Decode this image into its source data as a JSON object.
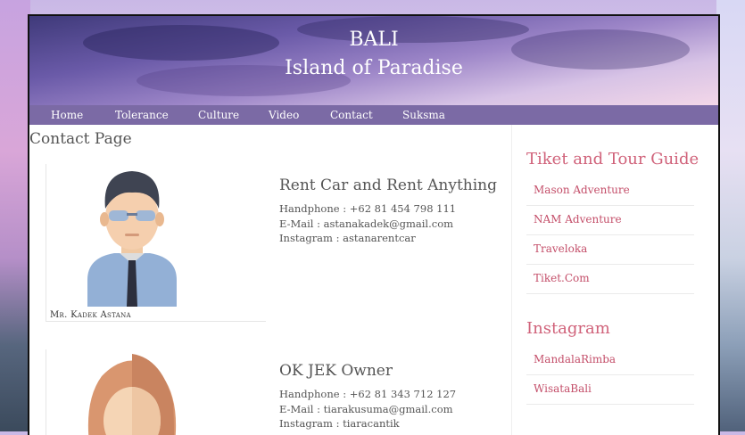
{
  "header": {
    "title": "BALI",
    "subtitle": "Island of Paradise"
  },
  "nav": [
    "Home",
    "Tolerance",
    "Culture",
    "Video",
    "Contact",
    "Suksma"
  ],
  "page_title": "Contact Page",
  "contacts": [
    {
      "name": "Mr. Kadek Astana",
      "heading": "Rent Car and Rent Anything",
      "phone": "Handphone : +62 81 454 798 111",
      "email": "E-Mail : astanakadek@gmail.com",
      "instagram": "Instagram : astanarentcar"
    },
    {
      "name": "",
      "heading": "OK JEK Owner",
      "phone": "Handphone : +62 81 343 712 127",
      "email": "E-Mail : tiarakusuma@gmail.com",
      "instagram": "Instagram : tiaracantik"
    }
  ],
  "sidebar": {
    "tour_title": "Tiket and Tour Guide",
    "tour_links": [
      "Mason Adventure",
      "NAM Adventure",
      "Traveloka",
      "Tiket.Com"
    ],
    "instagram_title": "Instagram",
    "instagram_links": [
      "MandalaRimba",
      "WisataBali"
    ]
  },
  "colors": {
    "nav_bg": "#7b6aa5",
    "accent": "#d0627a",
    "text": "#555555"
  }
}
